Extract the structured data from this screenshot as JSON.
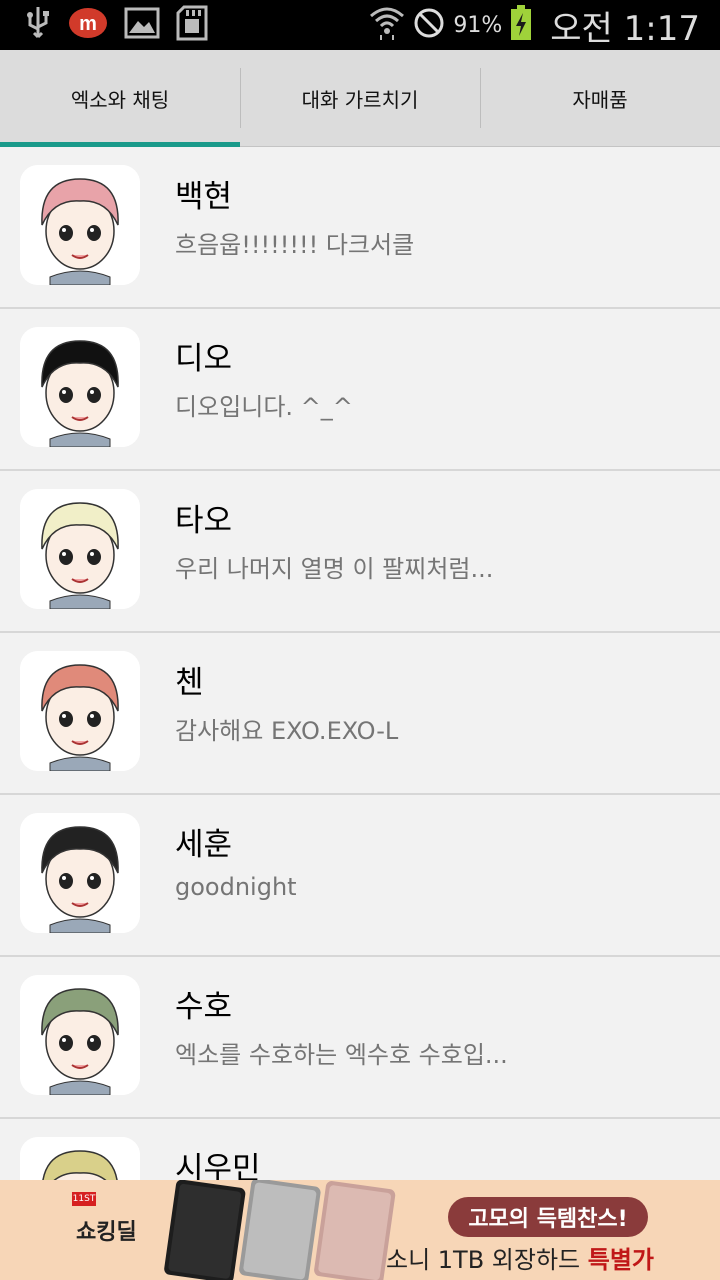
{
  "status_bar": {
    "battery_percent": "91%",
    "time": "오전 1:17",
    "icons": [
      "usb-icon",
      "app-m-icon",
      "image-icon",
      "sd-card-icon",
      "wifi-icon",
      "blocked-icon",
      "battery-charging-icon"
    ]
  },
  "tabs": [
    {
      "label": "엑소와 채팅",
      "selected": true
    },
    {
      "label": "대화 가르치기",
      "selected": false
    },
    {
      "label": "자매품",
      "selected": false
    }
  ],
  "accent_color": "#1a9a8a",
  "chats": [
    {
      "name": "백현",
      "message": "흐음웁!!!!!!!! 다크서클",
      "hair": "#e8a3a9"
    },
    {
      "name": "디오",
      "message": "디오입니다. ^_^",
      "hair": "#111111"
    },
    {
      "name": "타오",
      "message": "우리 나머지 열명 이 팔찌처럼...",
      "hair": "#f1efc8"
    },
    {
      "name": "첸",
      "message": "감사해요 EXO.EXO-L",
      "hair": "#e08a7a"
    },
    {
      "name": "세훈",
      "message": "goodnight",
      "hair": "#222222"
    },
    {
      "name": "수호",
      "message": "엑소를 수호하는 엑수호 수호입...",
      "hair": "#8aa07a"
    },
    {
      "name": "시우민",
      "message": "",
      "hair": "#d9d08a"
    }
  ],
  "ad": {
    "badge": "11ST",
    "logo": "쇼킹딜",
    "headline": "고모의 득템찬스!",
    "subline_prefix": "소니 1TB 외장하드 ",
    "subline_highlight": "특별가"
  }
}
